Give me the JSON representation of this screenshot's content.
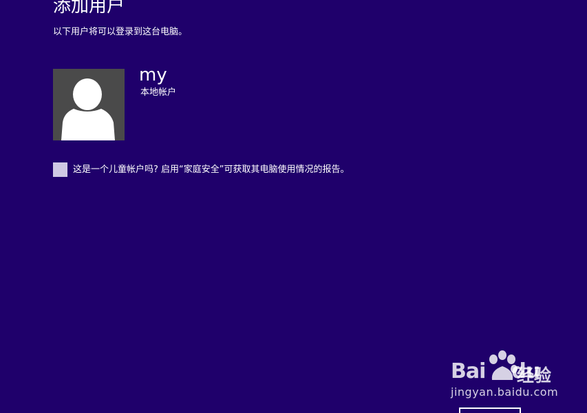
{
  "header": {
    "title": "添加用户",
    "subtitle": "以下用户将可以登录到这台电脑。"
  },
  "account": {
    "name": "my",
    "type": "本地帐户",
    "avatar_icon": "user-silhouette-icon"
  },
  "child_account": {
    "checked": false,
    "label": "这是一个儿童帐户吗? 启用“家庭安全”可获取其电脑使用情况的报告。"
  },
  "watermark": {
    "logo_text": "Bai",
    "logo_suffix": "du",
    "jingyan": "经验",
    "url": "jingyan.baidu.com"
  },
  "colors": {
    "background": "#1f006b",
    "text": "#ffffff",
    "tile": "#4a4a4a",
    "checkbox": "#cfc9e4"
  }
}
